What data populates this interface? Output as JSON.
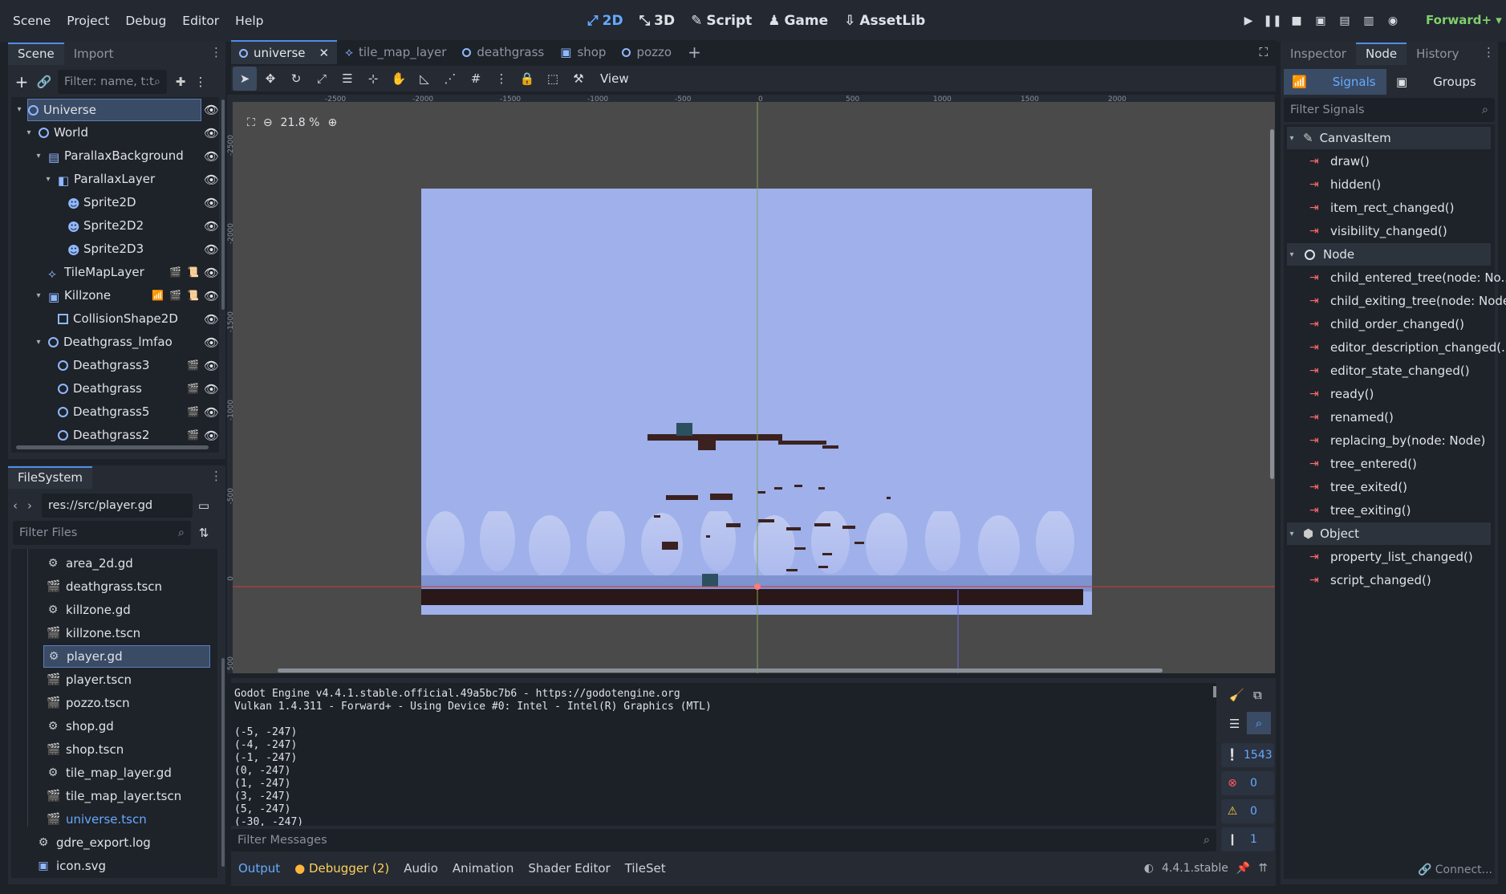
{
  "menu": [
    "Scene",
    "Project",
    "Debug",
    "Editor",
    "Help"
  ],
  "workspaces": {
    "w2d": "2D",
    "w3d": "3D",
    "script": "Script",
    "game": "Game",
    "assetlib": "AssetLib"
  },
  "renderer": "Forward+",
  "scene_dock": {
    "tabs": [
      "Scene",
      "Import"
    ],
    "filter_placeholder": "Filter: name, t:t",
    "tree": [
      {
        "label": "Universe",
        "depth": 0
      },
      {
        "label": "World",
        "depth": 1
      },
      {
        "label": "ParallaxBackground",
        "depth": 2
      },
      {
        "label": "ParallaxLayer",
        "depth": 3
      },
      {
        "label": "Sprite2D",
        "depth": 4
      },
      {
        "label": "Sprite2D2",
        "depth": 4
      },
      {
        "label": "Sprite2D3",
        "depth": 4
      },
      {
        "label": "TileMapLayer",
        "depth": 2
      },
      {
        "label": "Killzone",
        "depth": 2
      },
      {
        "label": "CollisionShape2D",
        "depth": 3
      },
      {
        "label": "Deathgrass_lmfao",
        "depth": 2
      },
      {
        "label": "Deathgrass3",
        "depth": 3
      },
      {
        "label": "Deathgrass",
        "depth": 3
      },
      {
        "label": "Deathgrass5",
        "depth": 3
      },
      {
        "label": "Deathgrass2",
        "depth": 3
      }
    ]
  },
  "filesystem": {
    "title": "FileSystem",
    "path": "res://src/player.gd",
    "filter_placeholder": "Filter Files",
    "files": [
      {
        "label": "area_2d.gd",
        "type": "script"
      },
      {
        "label": "deathgrass.tscn",
        "type": "scene"
      },
      {
        "label": "killzone.gd",
        "type": "script"
      },
      {
        "label": "killzone.tscn",
        "type": "scene"
      },
      {
        "label": "player.gd",
        "type": "script"
      },
      {
        "label": "player.tscn",
        "type": "scene"
      },
      {
        "label": "pozzo.tscn",
        "type": "scene"
      },
      {
        "label": "shop.gd",
        "type": "script"
      },
      {
        "label": "shop.tscn",
        "type": "scene"
      },
      {
        "label": "tile_map_layer.gd",
        "type": "script"
      },
      {
        "label": "tile_map_layer.tscn",
        "type": "scene"
      },
      {
        "label": "universe.tscn",
        "type": "scene"
      },
      {
        "label": "gdre_export.log",
        "type": "file"
      },
      {
        "label": "icon.svg",
        "type": "image"
      }
    ]
  },
  "scene_tabs": [
    "universe",
    "tile_map_layer",
    "deathgrass",
    "shop",
    "pozzo"
  ],
  "toolbar": {
    "view_label": "View"
  },
  "zoom": "21.8 %",
  "ruler_h": [
    "-2500",
    "-2000",
    "-1500",
    "-1000",
    "-500",
    "0",
    "500",
    "1000",
    "1500",
    "2000"
  ],
  "ruler_v": [
    "-2500",
    "-2000",
    "-1500",
    "-1000",
    "-500",
    "0",
    "500"
  ],
  "output": {
    "lines": [
      "Godot Engine v4.4.1.stable.official.49a5bc7b6 - https://godotengine.org",
      "Vulkan 1.4.311 - Forward+ - Using Device #0: Intel - Intel(R) Graphics (MTL)",
      "",
      "(-5, -247)",
      "(-4, -247)",
      "(-1, -247)",
      "(0, -247)",
      "(1, -247)",
      "(3, -247)",
      "(5, -247)",
      "(-30, -247)"
    ],
    "filter_placeholder": "Filter Messages",
    "counts": {
      "messages": "1543",
      "errors": "0",
      "warnings": "0",
      "other": "1"
    }
  },
  "bottom_tabs": [
    "Output",
    "Debugger (2)",
    "Audio",
    "Animation",
    "Shader Editor",
    "TileSet"
  ],
  "version": "4.4.1.stable",
  "inspector": {
    "tabs": [
      "Inspector",
      "Node",
      "History"
    ],
    "subtabs": {
      "signals": "Signals",
      "groups": "Groups"
    },
    "filter_placeholder": "Filter Signals",
    "sections": [
      {
        "name": "CanvasItem",
        "signals": [
          "draw()",
          "hidden()",
          "item_rect_changed()",
          "visibility_changed()"
        ]
      },
      {
        "name": "Node",
        "signals": [
          "child_entered_tree(node: No...",
          "child_exiting_tree(node: Node)",
          "child_order_changed()",
          "editor_description_changed(...",
          "editor_state_changed()",
          "ready()",
          "renamed()",
          "replacing_by(node: Node)",
          "tree_entered()",
          "tree_exited()",
          "tree_exiting()"
        ]
      },
      {
        "name": "Object",
        "signals": [
          "property_list_changed()",
          "script_changed()"
        ]
      }
    ],
    "connect_label": "Connect..."
  },
  "colors": {
    "accent": "#66aaff",
    "sky": "#9fb0ea",
    "ground": "#2a1717",
    "signal": "#ff6b6b"
  }
}
